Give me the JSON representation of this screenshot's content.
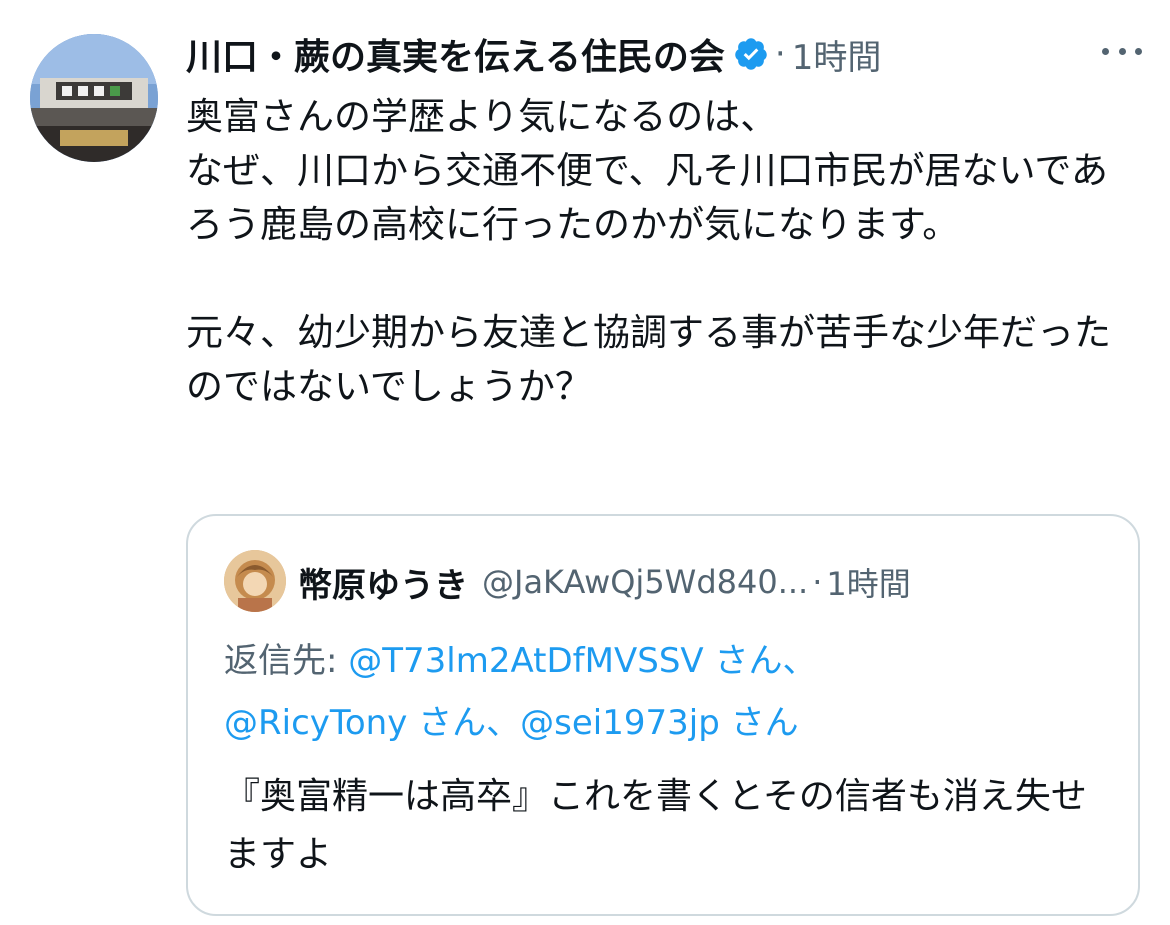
{
  "tweet": {
    "display_name": "川口・蕨の真実を伝える住民の会",
    "verified_icon": "verified-badge-icon",
    "separator": "·",
    "time": "1時間",
    "more_icon": "more-options-icon",
    "body": {
      "line1": "奥富さんの学歴より気になるのは、",
      "line2": "なぜ、川口から交通不便で、凡そ川口市民が居ないであろう鹿島の高校に行ったのかが気になります。",
      "line3": "元々、幼少期から友達と協調する事が苦手な少年だったのではないでしょうか？"
    }
  },
  "quote": {
    "display_name": "幣原ゆうき",
    "handle": "@JaKAwQj5Wd840...",
    "separator": "·",
    "time": "1時間",
    "reply_prefix": "返信先: ",
    "mentions": [
      {
        "handle": "@T73lm2AtDfMVSSV",
        "suffix": " さん、"
      },
      {
        "handle": "@RicyTony",
        "suffix": " さん、"
      },
      {
        "handle": "@sei1973jp",
        "suffix": " さん"
      }
    ],
    "text": "『奥富精一は高卒』これを書くとその信者も消え失せますよ"
  },
  "colors": {
    "text_primary": "#0f1419",
    "text_secondary": "#536471",
    "link": "#1d9bf0",
    "verified": "#1d9bf0",
    "border": "#cfd9de"
  }
}
